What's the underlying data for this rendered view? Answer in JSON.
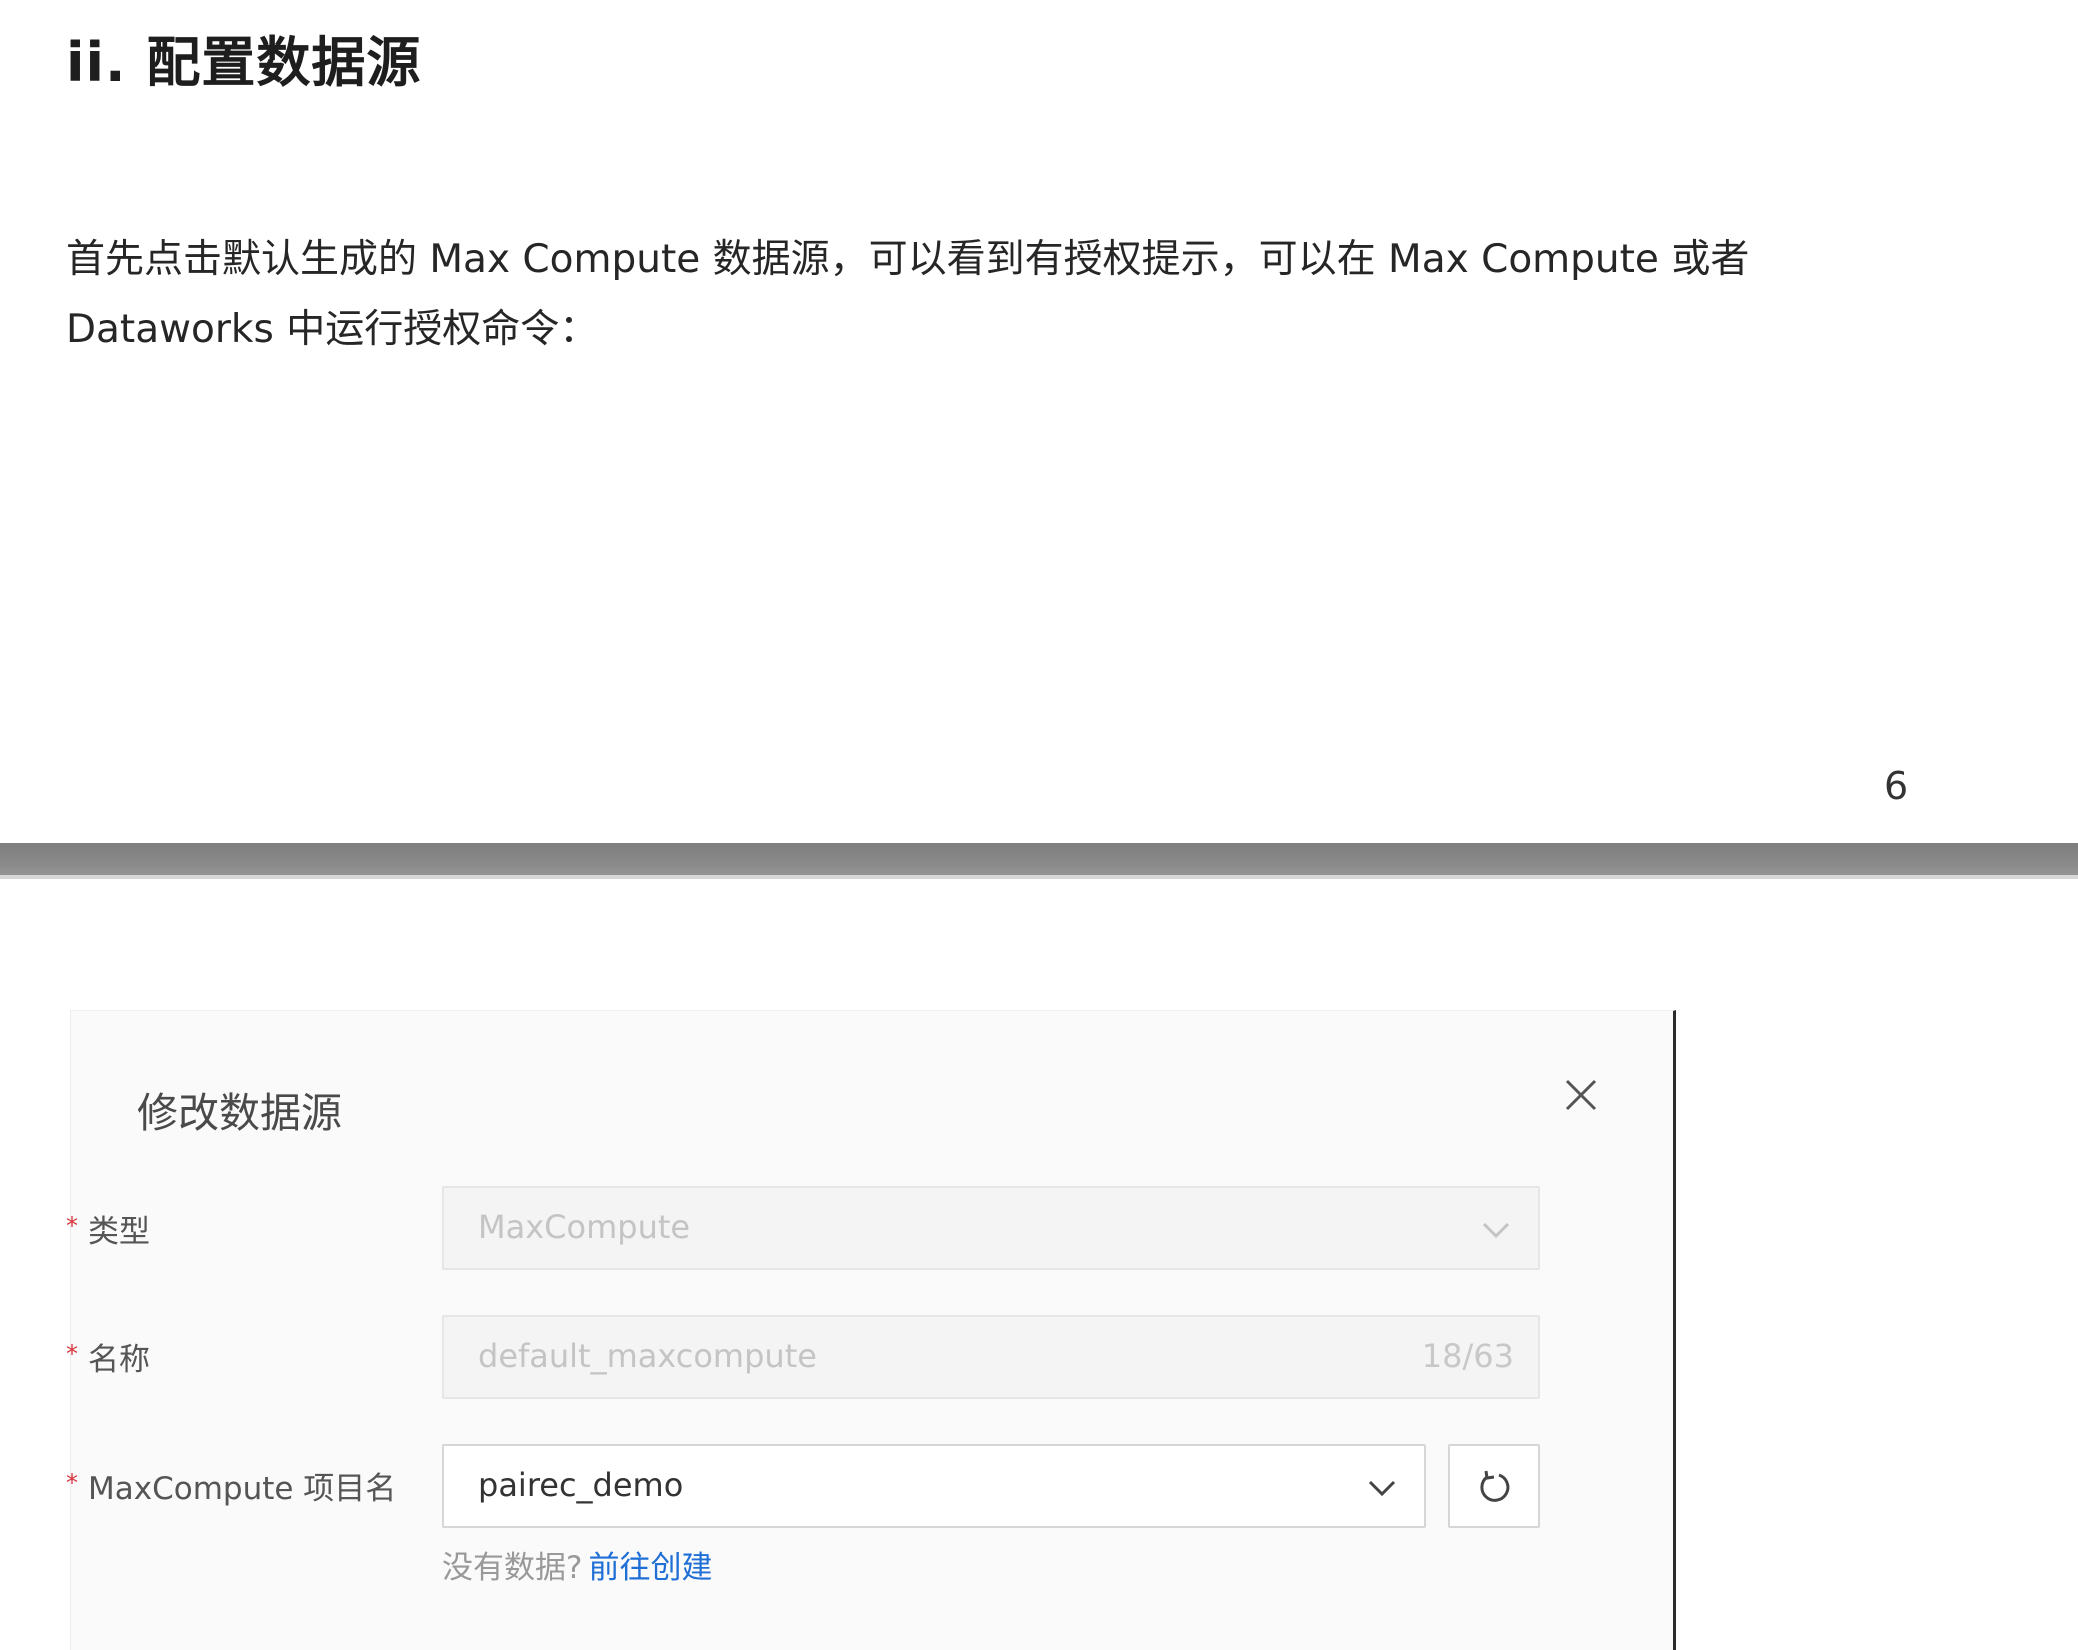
{
  "document": {
    "heading": "ii. 配置数据源",
    "paragraph_line1": "首先点击默认生成的 Max Compute 数据源，可以看到有授权提示，可以在 Max Compute 或者",
    "paragraph_line2": "Dataworks 中运行授权命令：",
    "page_number": "6"
  },
  "dialog": {
    "title": "修改数据源",
    "fields": {
      "type": {
        "label": "类型",
        "value": "MaxCompute",
        "required_mark": "*"
      },
      "name": {
        "label": "名称",
        "value": "default_maxcompute",
        "counter": "18/63",
        "required_mark": "*"
      },
      "project": {
        "label": "MaxCompute 项目名",
        "value": "pairec_demo",
        "required_mark": "*"
      }
    },
    "hint_text": "没有数据?",
    "hint_link": "前往创建"
  },
  "colors": {
    "required": "#d9363e",
    "link": "#1f6fd6",
    "page_gap": "#8a8a8a"
  },
  "icons": {
    "close": "close-icon",
    "dropdown": "chevron-down-icon",
    "refresh": "refresh-icon"
  }
}
